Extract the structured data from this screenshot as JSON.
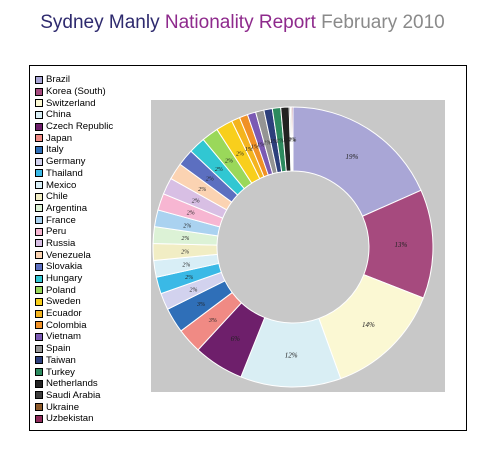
{
  "header": {
    "part1": "Sydney Manly",
    "part2": "Nationality Report",
    "part3": "February 2010"
  },
  "colors": {
    "title_part1": "#2e2a6e",
    "title_part2": "#8e2a8c",
    "title_part3": "#8a8a8a",
    "plot_background": "#c8c8c8"
  },
  "chart_data": {
    "type": "donut",
    "legend_position": "left",
    "categories": [
      "Brazil",
      "Korea (South)",
      "Switzerland",
      "China",
      "Czech Republic",
      "Japan",
      "Italy",
      "Germany",
      "Thailand",
      "Mexico",
      "Chile",
      "Argentina",
      "France",
      "Peru",
      "Russia",
      "Venezuela",
      "Slovakia",
      "Hungary",
      "Poland",
      "Sweden",
      "Ecuador",
      "Colombia",
      "Vietnam",
      "Spain",
      "Taiwan",
      "Turkey",
      "Netherlands",
      "Saudi Arabia",
      "Ukraine",
      "Uzbekistan"
    ],
    "values": [
      19,
      13,
      14,
      12,
      6,
      3,
      3,
      2,
      2,
      2,
      2,
      2,
      2,
      2,
      2,
      2,
      2,
      2,
      2,
      2,
      1,
      1,
      1,
      1,
      1,
      1,
      1,
      0,
      0,
      0
    ],
    "data_labels": [
      "19%",
      "13%",
      "14%",
      "12%",
      "6%",
      "3%",
      "3%",
      "2%",
      "2%",
      "2%",
      "2%",
      "2%",
      "2%",
      "2%",
      "2%",
      "2%",
      "2%",
      "2%",
      "2%",
      "2%",
      "1%",
      "1%",
      "1%",
      "1%",
      "1%",
      "1%",
      "1%",
      "0%",
      "0%",
      "0%"
    ],
    "colors": [
      "#a9a6d6",
      "#a64a7e",
      "#fbf8d3",
      "#d9eef4",
      "#6e1f6b",
      "#f08a84",
      "#2f6fb8",
      "#d2d2ee",
      "#3ab9e6",
      "#d8eef6",
      "#f1edc4",
      "#dcf2d6",
      "#aad2f0",
      "#f7b6d2",
      "#d8bfe4",
      "#fbd3b2",
      "#5c6fc0",
      "#31c7d2",
      "#9ad85a",
      "#f8cf1c",
      "#f4b41e",
      "#f09126",
      "#7b5ab4",
      "#949494",
      "#2d3f7c",
      "#2c8a5e",
      "#222222",
      "#3c3c3c",
      "#8e5a2a",
      "#8e2a5a"
    ]
  }
}
